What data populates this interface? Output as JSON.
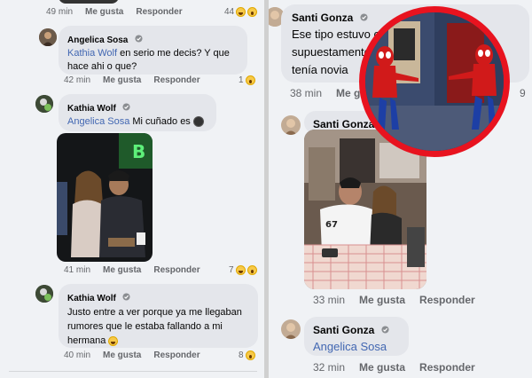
{
  "actions": {
    "like": "Me gusta",
    "reply": "Responder"
  },
  "left": {
    "top_meta": {
      "time": "49 min",
      "count": "44"
    },
    "comments": [
      {
        "author": "Angelica Sosa",
        "mention": "Kathia Wolf",
        "text": " en serio me decis? Y que hace ahi o que?",
        "time": "42 min",
        "count": "1"
      },
      {
        "author": "Kathia Wolf",
        "mention": "Angelica Sosa",
        "text": " Mi cuñado es",
        "time": "41 min",
        "count": "7"
      },
      {
        "author": "Kathia Wolf",
        "mention": "",
        "text": "Justo entre a ver porque ya me llegaban rumores que le estaba fallando a mi hermana",
        "time": "40 min",
        "count": "8"
      }
    ]
  },
  "right": {
    "comments": [
      {
        "author": "Santi Gonza",
        "text": "Ese tipo estuvo con una amiga, supuestamente, los mensajes, creo que tenía novia",
        "time": "38 min",
        "count": "9"
      },
      {
        "author": "Santi Gonza",
        "text": "",
        "time": "33 min",
        "count": ""
      },
      {
        "author": "Santi Gonza",
        "mention": "Angelica Sosa",
        "time": "32 min"
      }
    ]
  },
  "colors": {
    "accent_red": "#e8131f",
    "mention_blue": "#4267b2",
    "bubble": "#e4e6eb"
  },
  "icons": {
    "verified": "verified-badge-icon",
    "reactions": [
      "laugh-reaction-icon",
      "wow-reaction-icon"
    ]
  }
}
